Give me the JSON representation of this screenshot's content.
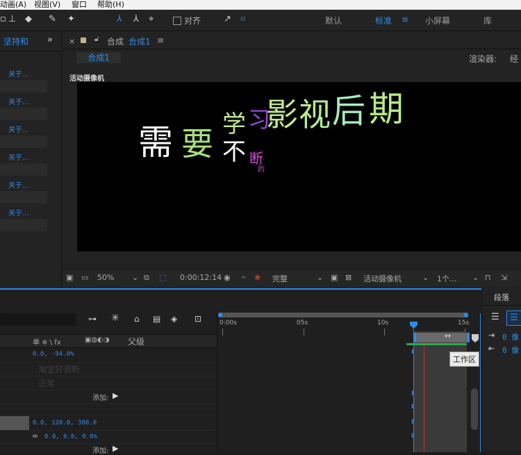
{
  "menu": [
    "动画(A)",
    "视图(V)",
    "窗口",
    "帮助(H)"
  ],
  "toolbar": {
    "snap_label": "对齐",
    "workspaces": [
      "默认",
      "标准",
      "小屏幕",
      "库"
    ]
  },
  "left_panel": {
    "title": "坚持和",
    "expand": "»",
    "links": [
      "关于...",
      "关于...",
      "关于...",
      "关于...",
      "关于...",
      "关于..."
    ]
  },
  "comp_panel": {
    "close": "×",
    "tab_prefix": "合成",
    "tab_name": "合成1",
    "menu": "≡",
    "sub_tab": "合成1",
    "renderer_label": "渲染器:",
    "renderer_value": "经"
  },
  "viewer": {
    "camera_label": "活动摄像机",
    "words": {
      "xu1": "需",
      "yao": "要",
      "xue": "学",
      "xi": "习",
      "bu": "不",
      "duan": "断",
      "de": "的",
      "ying": "影",
      "shi": "视",
      "hou": "后",
      "qi": "期"
    }
  },
  "viewer_controls": {
    "zoom": "50%",
    "timecode": "0:00:12:14",
    "resolution": "完整",
    "camera": "活动摄像机",
    "views": "1个..."
  },
  "timeline": {
    "header_labels": "单 ※ \\ fx",
    "parent_label": "父级",
    "ruler": [
      "0:00s",
      "05s",
      "10s",
      "15s"
    ],
    "work_area_tip": "工作区",
    "rows": [
      {
        "text": "0.0, -94.0%",
        "kind": "value"
      },
      {
        "text": "淘宝好调断",
        "kind": "ghost"
      },
      {
        "text": "正常",
        "kind": "ghost"
      },
      {
        "text": "添加:",
        "kind": "add"
      },
      {
        "text": "0.0, 120.0, 300.0",
        "kind": "value"
      },
      {
        "text": "0.0, 0.0, 0.0%",
        "kind": "value"
      },
      {
        "text": "添加:",
        "kind": "add"
      }
    ]
  },
  "right_panel": {
    "tab": "段落",
    "values": [
      "0 像",
      "0 像"
    ]
  },
  "colors": {
    "accent": "#2d8ceb",
    "playhead": "#d9252b",
    "workarea": "#2fa84f"
  }
}
